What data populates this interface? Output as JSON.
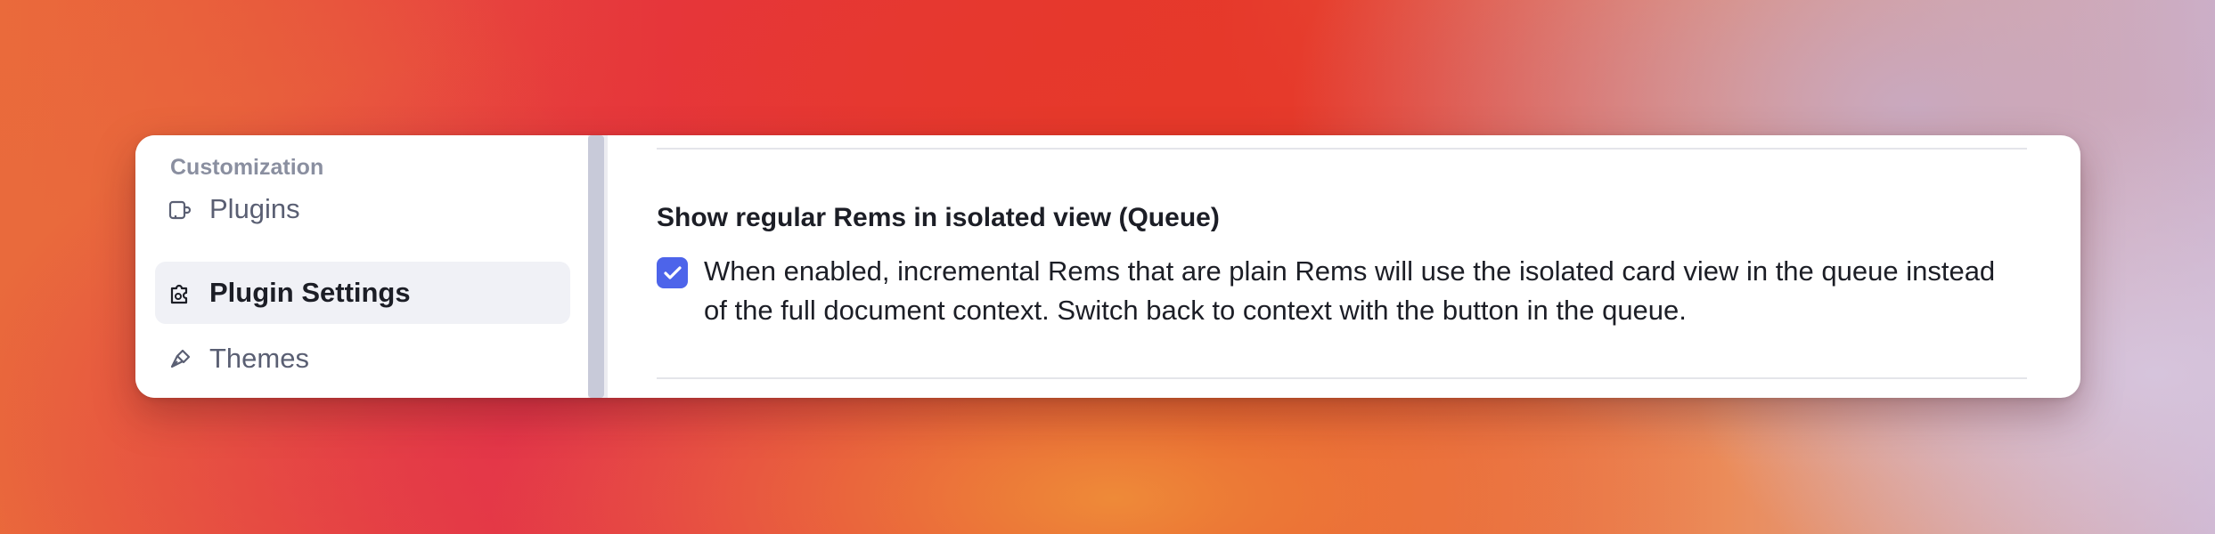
{
  "sidebar": {
    "section_label": "Customization",
    "items": [
      {
        "label": "Plugins",
        "icon": "plugin-icon",
        "active": false
      },
      {
        "label": "Plugin Settings",
        "icon": "puzzle-settings-icon",
        "active": true
      },
      {
        "label": "Themes",
        "icon": "brush-icon",
        "active": false
      }
    ]
  },
  "setting": {
    "title": "Show regular Rems in isolated view (Queue)",
    "checked": true,
    "description": "When enabled, incremental Rems that are plain Rems will use the isolated card view in the queue instead of the full document context. Switch back to context with the button in the queue."
  },
  "colors": {
    "accent": "#4d64ea",
    "active_item_bg": "#f0f1f6",
    "section_label": "#8a8fa0"
  }
}
